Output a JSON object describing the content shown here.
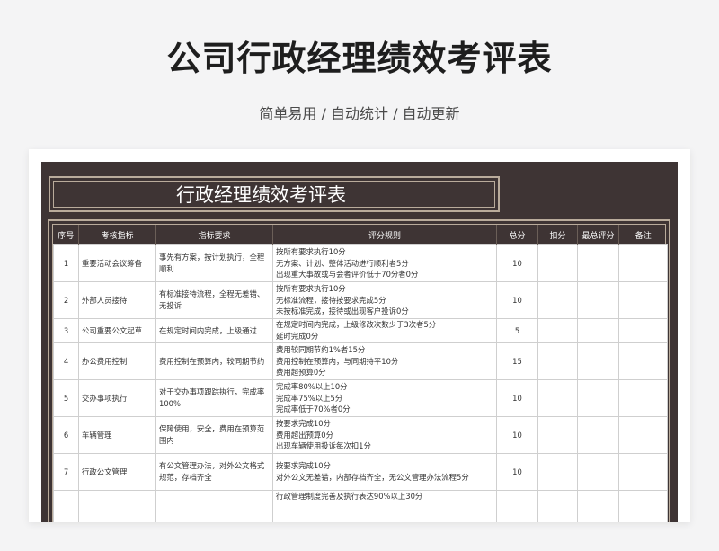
{
  "page": {
    "title": "公司行政经理绩效考评表",
    "subtitle": "简单易用 / 自动统计 / 自动更新"
  },
  "sheet": {
    "title": "行政经理绩效考评表",
    "headers": [
      "序号",
      "考核指标",
      "指标要求",
      "评分规则",
      "总分",
      "扣分",
      "最总评分",
      "备注"
    ],
    "rows": [
      {
        "no": "1",
        "metric": "重要活动会议筹备",
        "requirement": "事先有方案，按计划执行，全程顺利",
        "rules": [
          "按所有要求执行10分",
          "无方案、计划、整体活动进行顺利者5分",
          "出现重大事故或与会者评价低于70分者0分"
        ],
        "total": "10"
      },
      {
        "no": "2",
        "metric": "外部人员接待",
        "requirement": "有标准接待流程，全程无差错、无投诉",
        "rules": [
          "按所有要求执行10分",
          "无标准流程，接待按要求完成5分",
          "未按标准完成，接待或出现客户投诉0分"
        ],
        "total": "10"
      },
      {
        "no": "3",
        "metric": "公司重要公文起草",
        "requirement": "在规定时间内完成，上级通过",
        "rules": [
          "在规定时间内完成，上级修改次数少于3次者5分",
          "延时完成0分"
        ],
        "total": "5"
      },
      {
        "no": "4",
        "metric": "办公费用控制",
        "requirement": "费用控制在预算内，较同期节约",
        "rules": [
          "费用较同期节约1%者15分",
          "费用控制在预算内，与同期持平10分",
          "费用超预算0分"
        ],
        "total": "15"
      },
      {
        "no": "5",
        "metric": "交办事项执行",
        "requirement": "对于交办事项跟踪执行，完成率100%",
        "rules": [
          "完成率80%以上10分",
          "完成率75%以上5分",
          "完成率低于70%者0分"
        ],
        "total": "10"
      },
      {
        "no": "6",
        "metric": "车辆管理",
        "requirement": "保障使用，安全，费用在预算范围内",
        "rules": [
          "按要求完成10分",
          "费用超出预算0分",
          "出现车辆使用投诉每次扣1分"
        ],
        "total": "10"
      },
      {
        "no": "7",
        "metric": "行政公文管理",
        "requirement": "有公文管理办法，对外公文格式规范，存档齐全",
        "rules": [
          "按要求完成10分",
          "对外公文无差错，内部存档齐全，无公文管理办法流程5分"
        ],
        "total": "10"
      },
      {
        "no": "",
        "metric": "",
        "requirement": "",
        "rules": [
          "行政管理制度完善及执行表达90%以上30分"
        ],
        "total": ""
      }
    ]
  }
}
